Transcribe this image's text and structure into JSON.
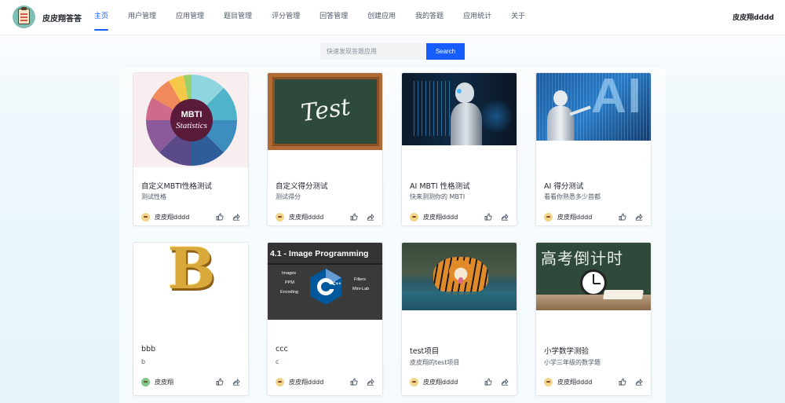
{
  "header": {
    "site_name": "皮皮翔答答",
    "user_name": "皮皮翔dddd",
    "nav": [
      {
        "label": "主页",
        "active": true
      },
      {
        "label": "用户管理"
      },
      {
        "label": "应用管理"
      },
      {
        "label": "题目管理"
      },
      {
        "label": "评分管理"
      },
      {
        "label": "回答管理"
      },
      {
        "label": "创建应用"
      },
      {
        "label": "我的答题"
      },
      {
        "label": "应用统计"
      },
      {
        "label": "关于"
      }
    ]
  },
  "search": {
    "placeholder": "快速发现答题应用",
    "button_label": "Search"
  },
  "cover_text": {
    "mbti_line1": "MBTI",
    "mbti_line2": "Statistics",
    "test": "Test",
    "ai": "AI",
    "b": "B",
    "image_prog": "4.1 - Image Programming",
    "image_prog_images": "Images",
    "image_prog_ppm": "PPM",
    "image_prog_encoding": "Encoding",
    "image_prog_filters": "Filters",
    "image_prog_minilab": "Mini-Lab",
    "cpp": "C++",
    "gaokao": "高考倒计时"
  },
  "apps": [
    {
      "title": "自定义MBTI性格测试",
      "desc": "测试性格",
      "author": "皮皮翔dddd",
      "cover": "mbti-chart"
    },
    {
      "title": "自定义得分测试",
      "desc": "测试得分",
      "author": "皮皮翔dddd",
      "cover": "chalkboard-test"
    },
    {
      "title": "AI MBTI 性格测试",
      "desc": "快来测测你的 MBTI",
      "author": "皮皮翔dddd",
      "cover": "ai-robot"
    },
    {
      "title": "AI 得分测试",
      "desc": "看看你熟悉多少首都",
      "author": "皮皮翔dddd",
      "cover": "ai-robot-2"
    },
    {
      "title": "bbb",
      "desc": "b",
      "author": "皮皮翔",
      "cover": "gold-letter-b"
    },
    {
      "title": "ccc",
      "desc": "c",
      "author": "皮皮翔dddd",
      "cover": "image-programming"
    },
    {
      "title": "test项目",
      "desc": "皮皮翔的test项目",
      "author": "皮皮翔dddd",
      "cover": "tiger"
    },
    {
      "title": "小学数学测验",
      "desc": "小学三年级的数学题",
      "author": "皮皮翔dddd",
      "cover": "gaokao-clock"
    }
  ],
  "icons": {
    "like": "thumb-up-icon",
    "share": "share-icon"
  },
  "colors": {
    "primary": "#165dff",
    "nav_text": "#4e5969",
    "title_text": "#1d2129"
  }
}
